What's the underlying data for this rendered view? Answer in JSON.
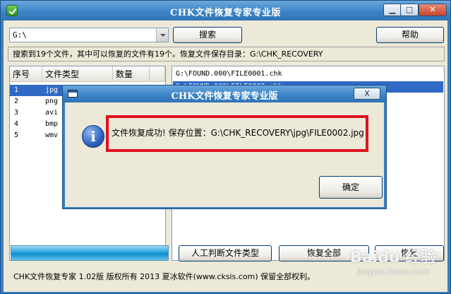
{
  "window": {
    "title": "CHK文件恢复专家专业版",
    "min_label": "▁",
    "max_label": "□",
    "close_label": "✕"
  },
  "toolbar": {
    "path_value": "G:\\",
    "search_label": "搜索",
    "help_label": "帮助"
  },
  "status_top": "搜索到19个文件，其中可以恢复的文件有19个。恢复文件保存目录：G:\\CHK_RECOVERY",
  "type_list": {
    "headers": [
      "序号",
      "文件类型",
      "数量"
    ],
    "rows": [
      {
        "no": "1",
        "type": "jpg",
        "count": ""
      },
      {
        "no": "2",
        "type": "png",
        "count": ""
      },
      {
        "no": "3",
        "type": "avi",
        "count": ""
      },
      {
        "no": "4",
        "type": "bmp",
        "count": ""
      },
      {
        "no": "5",
        "type": "wmv",
        "count": ""
      }
    ],
    "selected_index": 0
  },
  "file_list": {
    "rows": [
      "G:\\FOUND.000\\FILE0001.chk",
      "G:\\FOUND.000\\FILE0002.chk"
    ],
    "selected_index": 1
  },
  "actions": {
    "manual_type_label": "人工判断文件类型",
    "recover_all_label": "恢复全部",
    "recover_label": "恢复"
  },
  "status_bottom": "CHK文件恢复专家 1.02版  版权所有 2013 夏冰软件(www.cksis.com) 保留全部权利。",
  "dialog": {
    "title": "CHK文件恢复专家专业版",
    "close_label": "X",
    "message": "文件恢复成功! 保存位置：G:\\CHK_RECOVERY\\jpg\\FILE0002.jpg",
    "ok_label": "确定",
    "icon": "info-icon"
  },
  "watermark": {
    "text": "Baidu 经验",
    "sub": "jingyan.baidu.com"
  }
}
